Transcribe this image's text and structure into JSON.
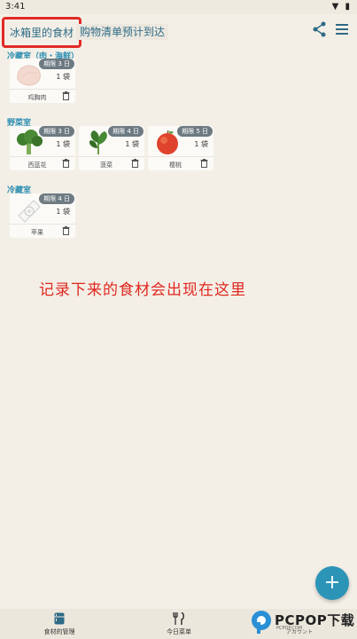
{
  "status": {
    "time": "3:41"
  },
  "tabs": [
    {
      "label": "冰箱里的食材"
    },
    {
      "label": "购物清单预计到达"
    }
  ],
  "sections": [
    {
      "title": "冷藏室（肉・海鲜）",
      "items": [
        {
          "badge": "期限 3 日",
          "qty": "1 袋",
          "name": "鸡胸肉"
        }
      ]
    },
    {
      "title": "野菜室",
      "items": [
        {
          "badge": "期限 3 日",
          "qty": "1 袋",
          "name": "西蓝花"
        },
        {
          "badge": "期限 4 日",
          "qty": "1 袋",
          "name": "菠菜"
        },
        {
          "badge": "期限 5 日",
          "qty": "1 袋",
          "name": "樱桃"
        }
      ]
    },
    {
      "title": "冷藏室",
      "items": [
        {
          "badge": "期限 4 日",
          "qty": "1 袋",
          "name": "苹果"
        }
      ]
    }
  ],
  "annotation": "记录下来的食材会出现在这里",
  "fab": {
    "label": "+"
  },
  "nav": [
    {
      "label": "食材的管理"
    },
    {
      "label": "今日菜单"
    },
    {
      "label": "アカウント"
    }
  ],
  "watermark": {
    "text": "PCPOP下载",
    "sub": "PCPOP.COM"
  },
  "colors": {
    "accent": "#2b94b7",
    "tab_text": "#2d6a86",
    "highlight_border": "#e12a26",
    "annotation": "#e0281f",
    "badge": "#6d7a82"
  }
}
